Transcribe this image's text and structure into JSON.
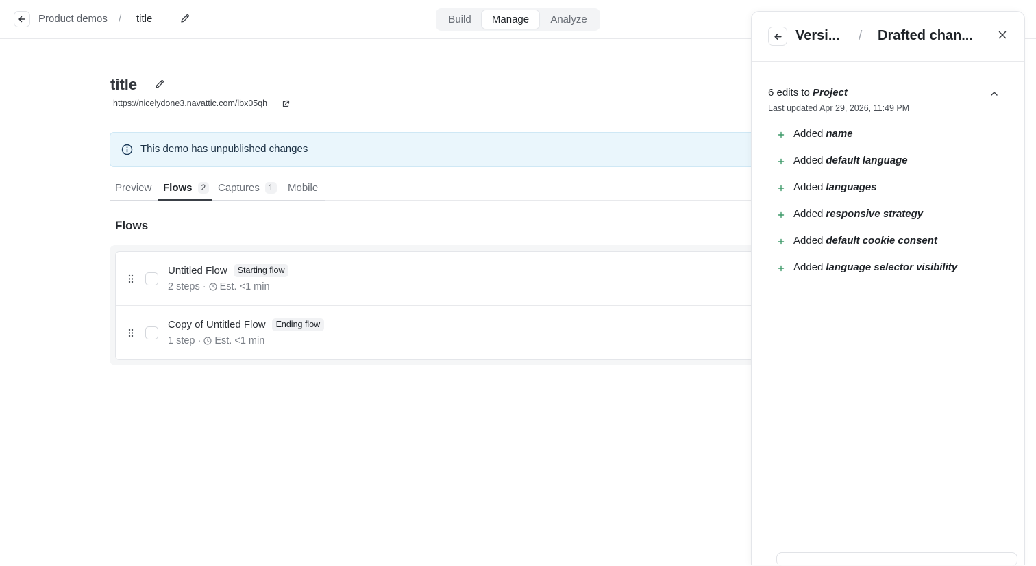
{
  "topbar": {
    "breadcrumb_parent": "Product demos",
    "breadcrumb_separator": "/",
    "breadcrumb_current": "title",
    "segments": {
      "build": "Build",
      "manage": "Manage",
      "analyze": "Analyze",
      "active": "Manage"
    }
  },
  "page": {
    "title": "title",
    "url": "https://nicelydone3.navattic.com/lbx05qh",
    "banner_text": "This demo has unpublished changes",
    "tabs": [
      {
        "label": "Preview",
        "count": null
      },
      {
        "label": "Flows",
        "count": "2"
      },
      {
        "label": "Captures",
        "count": "1"
      },
      {
        "label": "Mobile",
        "count": null
      }
    ],
    "active_tab": "Flows",
    "section_title": "Flows",
    "flows": [
      {
        "name": "Untitled Flow",
        "tag": "Starting flow",
        "steps": "2 steps",
        "sep": "·",
        "estimate": "Est. <1 min"
      },
      {
        "name": "Copy of Untitled Flow",
        "tag": "Ending flow",
        "steps": "1 step",
        "sep": "·",
        "estimate": "Est. <1 min"
      }
    ]
  },
  "panel": {
    "crumb_parent": "Versi...",
    "crumb_separator": "/",
    "crumb_current": "Drafted chan...",
    "edits_count_text": "6 edits to",
    "edits_target": "Project",
    "last_updated": "Last updated Apr 29, 2026, 11:49 PM",
    "changes": [
      {
        "action": "Added",
        "field": "name"
      },
      {
        "action": "Added",
        "field": "default language"
      },
      {
        "action": "Added",
        "field": "languages"
      },
      {
        "action": "Added",
        "field": "responsive strategy"
      },
      {
        "action": "Added",
        "field": "default cookie consent"
      },
      {
        "action": "Added",
        "field": "language selector visibility"
      }
    ]
  },
  "colors": {
    "banner_bg": "#eaf6fc",
    "plus_green": "#3f9a6a",
    "active_tab_underline": "#3a3f46"
  },
  "icons": {
    "back": "arrow-left-icon",
    "edit": "pencil-icon",
    "external": "external-link-icon",
    "info": "info-circle-icon",
    "drag": "drag-handle-icon",
    "clock": "clock-icon",
    "close": "close-icon",
    "collapse": "chevron-up-icon",
    "plus": "plus-icon"
  }
}
